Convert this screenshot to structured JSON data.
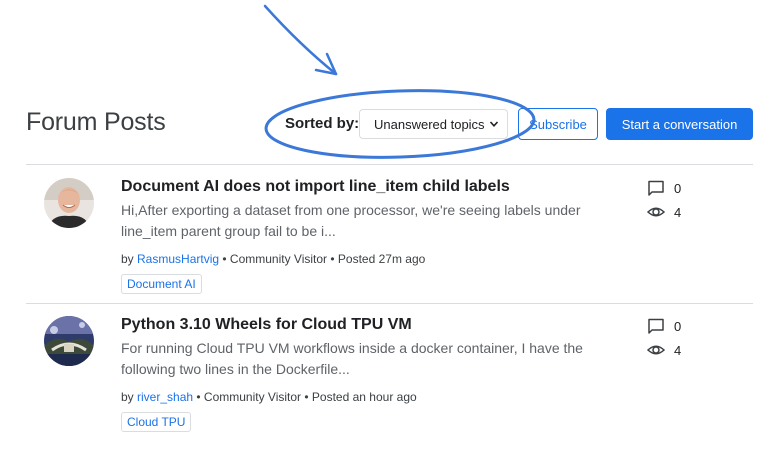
{
  "header": {
    "title": "Forum Posts",
    "sort_label": "Sorted by:",
    "sort_value": "Unanswered topics",
    "subscribe_label": "Subscribe",
    "start_label": "Start a conversation"
  },
  "posts": [
    {
      "title": "Document AI does not import line_item child labels",
      "snippet": "Hi,After exporting a dataset from one processor, we're seeing labels under line_item parent group fail to be i...",
      "by": "by ",
      "author": "RasmusHartvig",
      "meta_rest": " • Community Visitor • Posted 27m ago",
      "tag": "Document AI",
      "replies": "0",
      "views": "4"
    },
    {
      "title": "Python 3.10 Wheels for Cloud TPU VM",
      "snippet": "For running Cloud TPU VM workflows inside a docker container, I have the following two lines in the Dockerfile...",
      "by": "by ",
      "author": "river_shah",
      "meta_rest": " • Community Visitor • Posted an hour ago",
      "tag": "Cloud TPU",
      "replies": "0",
      "views": "4"
    }
  ],
  "colors": {
    "accent": "#1a73e8",
    "annotation": "#3b78d8"
  },
  "icons": {
    "replies": "comment-icon",
    "views": "eye-icon"
  }
}
